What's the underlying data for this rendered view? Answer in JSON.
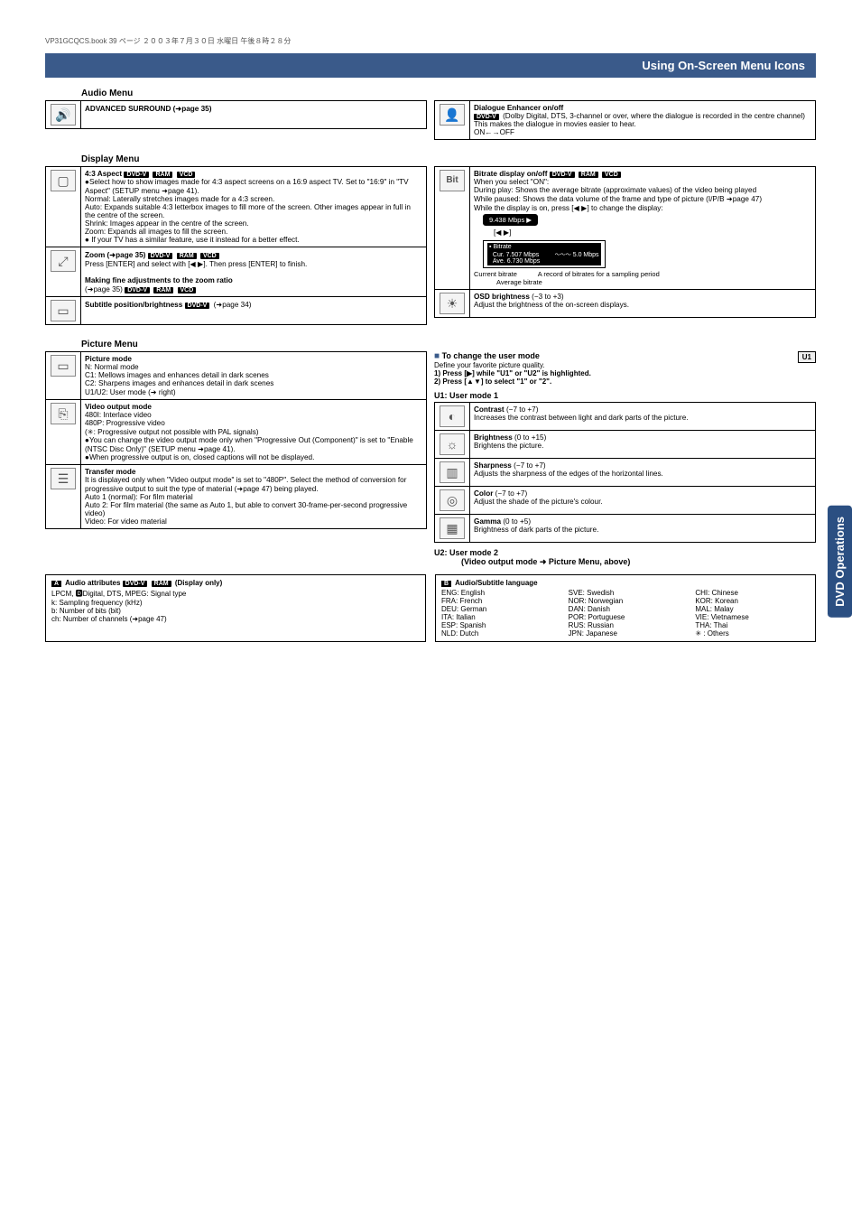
{
  "bookmeta": "VP31GCQCS.book  39 ページ  ２００３年７月３０日  水曜日  午後８時２８分",
  "page_header": "Using On-Screen Menu Icons",
  "side_tab": "DVD Operations",
  "audio_menu": {
    "title": "Audio Menu",
    "advanced_surround": "ADVANCED SURROUND (➜page 35)",
    "dialogue": {
      "title": "Dialogue Enhancer on/off",
      "badge": "DVD-V",
      "cond": "(Dolby Digital, DTS, 3-channel or over, where the dialogue is recorded in the centre channel)",
      "desc": "This makes the dialogue in movies easier to hear.",
      "toggle": "ON←→OFF"
    }
  },
  "display_menu": {
    "title": "Display Menu",
    "aspect": {
      "heading": "4:3 Aspect",
      "badges": [
        "DVD-V",
        "RAM",
        "VCD"
      ],
      "line1": "●Select how to show images made for 4:3 aspect screens on a 16:9 aspect TV. Set to \"16:9\" in \"TV Aspect\" (SETUP menu ➜page 41).",
      "normal": "Normal: Laterally stretches images made for a 4:3 screen.",
      "auto": "Auto: Expands suitable 4:3 letterbox images to fill more of the screen. Other images appear in full in the centre of the screen.",
      "shrink": "Shrink: Images appear in the centre of the screen.",
      "zoom": "Zoom: Expands all images to fill the screen.",
      "note": "● If your TV has a similar feature, use it instead for a better effect."
    },
    "zoom_row": {
      "heading": "Zoom (➜page 35)",
      "badges": [
        "DVD-V",
        "RAM",
        "VCD"
      ],
      "line1": "Press [ENTER] and select with [◀ ▶]. Then press [ENTER] to finish.",
      "sub": "Making fine adjustments to the zoom ratio",
      "sub_ref": "(➜page 35)",
      "sub_badges": [
        "DVD-V",
        "RAM",
        "VCD"
      ]
    },
    "subtitle_row": {
      "heading": "Subtitle position/brightness",
      "badge": "DVD-V",
      "ref": "(➜page 34)"
    },
    "bitrate": {
      "heading": "Bitrate display on/off",
      "badges": [
        "DVD-V",
        "RAM",
        "VCD"
      ],
      "l1": "When you select \"ON\":",
      "l2": "During play:  Shows the average bitrate (approximate values) of the video being played",
      "l3": "While paused: Shows the data volume of the frame and type of picture (I/P/B ➜page 47)",
      "l4": "While the display is on, press [◀ ▶] to change the display:",
      "pill": "9.438 Mbps  ▶",
      "pill2": "[◀ ▶]",
      "chart_title": "Bitrate",
      "chart_l1": "Cur.  7.507 Mbps",
      "chart_l2": "Ave.  6.730 Mbps",
      "chart_scale": "5.0 Mbps",
      "lbl_current": "Current bitrate",
      "lbl_avg": "Average bitrate",
      "lbl_record": "A record of bitrates for a sampling period"
    },
    "osd": {
      "heading": "OSD brightness",
      "range": "(−3 to +3)",
      "desc": "Adjust the brightness of the on-screen displays."
    }
  },
  "picture_menu": {
    "title": "Picture Menu",
    "mode": {
      "heading": "Picture mode",
      "n": "N:     Normal mode",
      "c1": "C1:   Mellows images and enhances detail in dark scenes",
      "c2": "C2:   Sharpens images and enhances detail in dark scenes",
      "u": "U1/U2: User mode (➜ right)"
    },
    "video_out": {
      "heading": "Video output mode",
      "l1": "480I:  Interlace video",
      "l2": "480P: Progressive video",
      "l3": "(✳:   Progressive output not possible with PAL signals)",
      "b1": "●You can change the video output mode only when \"Progressive Out (Component)\" is set to \"Enable (NTSC Disc Only)\" (SETUP menu ➜page 41).",
      "b2": "●When progressive output is on, closed captions will not be displayed."
    },
    "transfer": {
      "heading": "Transfer mode",
      "l1": "It is displayed only when \"Video output mode\" is set to \"480P\". Select the method of conversion for progressive output to suit the type of material (➜page 47) being played.",
      "a1": "Auto 1 (normal): For film material",
      "a2": "Auto 2: For film material (the same as Auto 1, but able to convert 30-frame-per-second progressive video)",
      "v": "Video:  For video material"
    },
    "change_user": {
      "heading": "To change the user mode",
      "l1": "Define your favorite picture quality.",
      "s1": "1)  Press [▶] while \"U1\" or \"U2\" is highlighted.",
      "s2": "2)  Press [▲▼] to select \"1\" or \"2\".",
      "u1": "U1:   User mode 1",
      "u2": "U2:   User mode 2",
      "u2_note": "(Video output mode ➜ Picture Menu, above)"
    },
    "params": {
      "contrast": {
        "h": "Contrast",
        "r": "(−7 to +7)",
        "d": "Increases the contrast between light and dark parts of the picture."
      },
      "brightness": {
        "h": "Brightness",
        "r": "(0 to +15)",
        "d": "Brightens the picture."
      },
      "sharpness": {
        "h": "Sharpness",
        "r": "(−7 to +7)",
        "d": "Adjusts the sharpness of the edges of the horizontal lines."
      },
      "color": {
        "h": "Color",
        "r": "(−7 to +7)",
        "d": "Adjust the shade of the picture's colour."
      },
      "gamma": {
        "h": "Gamma",
        "r": "(0 to +5)",
        "d": "Brightness of dark parts of the picture."
      }
    }
  },
  "audio_attr": {
    "header": "Audio attributes",
    "badges": [
      "DVD-V",
      "RAM"
    ],
    "note": "(Display only)",
    "l1": "LPCM, 🅳Digital, DTS, MPEG: Signal type",
    "k": "k:   Sampling frequency (kHz)",
    "b": "b:   Number of bits (bit)",
    "ch": "ch:  Number of channels (➜page 47)"
  },
  "lang": {
    "header": "Audio/Subtitle language",
    "col1": {
      "ENG": "English",
      "FRA": "French",
      "DEU": "German",
      "ITA": "Italian",
      "ESP": "Spanish",
      "NLD": "Dutch"
    },
    "col2": {
      "SVE": "Swedish",
      "NOR": "Norwegian",
      "DAN": "Danish",
      "POR": "Portuguese",
      "RUS": "Russian",
      "JPN": "Japanese"
    },
    "col3": {
      "CHI": "Chinese",
      "KOR": "Korean",
      "MAL": "Malay",
      "VIE": "Vietnamese",
      "THA": "Thai",
      "AST": "Others"
    }
  }
}
